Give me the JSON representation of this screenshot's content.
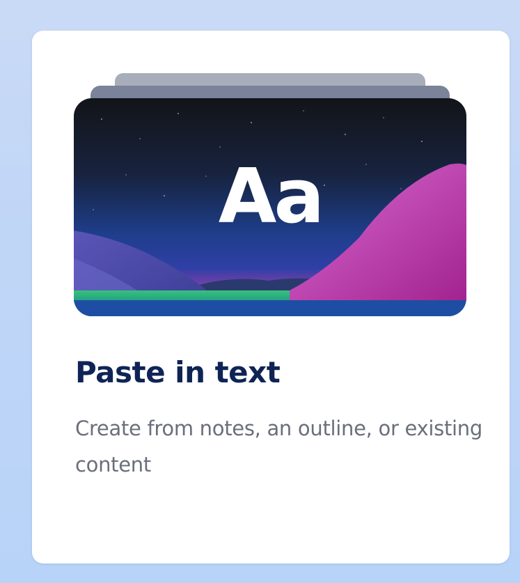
{
  "card": {
    "thumbnail_text": "Aa",
    "title": "Paste in text",
    "description": "Create from notes, an outline, or existing content"
  },
  "colors": {
    "page_background": "#c3d8f7",
    "title": "#0f2455",
    "description": "#6b6f7b"
  }
}
